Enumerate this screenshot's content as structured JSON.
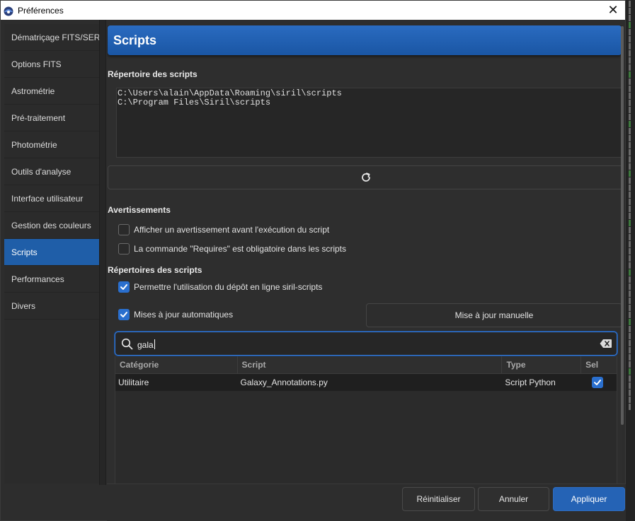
{
  "window": {
    "title": "Préférences",
    "close_glyph": "✕"
  },
  "sidebar": {
    "items": [
      {
        "label": "Dématriçage FITS/SER",
        "active": false
      },
      {
        "label": "Options FITS",
        "active": false
      },
      {
        "label": "Astrométrie",
        "active": false
      },
      {
        "label": "Pré-traitement",
        "active": false
      },
      {
        "label": "Photométrie",
        "active": false
      },
      {
        "label": "Outils d'analyse",
        "active": false
      },
      {
        "label": "Interface utilisateur",
        "active": false
      },
      {
        "label": "Gestion des couleurs",
        "active": false
      },
      {
        "label": "Scripts",
        "active": true
      },
      {
        "label": "Performances",
        "active": false
      },
      {
        "label": "Divers",
        "active": false
      }
    ]
  },
  "main": {
    "header": "Scripts",
    "scripts_dir": {
      "title": "Répertoire des scripts",
      "lines": [
        "C:\\Users\\alain\\AppData\\Roaming\\siril\\scripts",
        "C:\\Program Files\\Siril\\scripts"
      ],
      "refresh_icon": "refresh-icon"
    },
    "warnings": {
      "title": "Avertissements",
      "warn_before_exec": {
        "label": "Afficher un avertissement avant l'exécution du script",
        "checked": false
      },
      "requires_mandatory": {
        "label": "La commande \"Requires\" est obligatoire dans les scripts",
        "checked": false
      }
    },
    "repos": {
      "title": "Répertoires des scripts",
      "allow_online": {
        "label": "Permettre l'utilisation du dépôt en ligne siril-scripts",
        "checked": true
      },
      "auto_updates": {
        "label": "Mises à jour automatiques",
        "checked": true
      },
      "manual_update_label": "Mise à jour manuelle"
    },
    "search": {
      "value": "gala"
    },
    "table": {
      "columns": [
        "Catégorie",
        "Script",
        "Type",
        "Sel"
      ],
      "rows": [
        {
          "category": "Utilitaire",
          "script": "Galaxy_Annotations.py",
          "type": "Script Python",
          "selected": true
        }
      ]
    }
  },
  "footer": {
    "reset_label": "Réinitialiser",
    "cancel_label": "Annuler",
    "apply_label": "Appliquer"
  },
  "colors": {
    "accent": "#1f5ea8",
    "header_blue": "#2a6bc0",
    "checkbox_on": "#2a6fce",
    "background": "#2d2d2d"
  }
}
